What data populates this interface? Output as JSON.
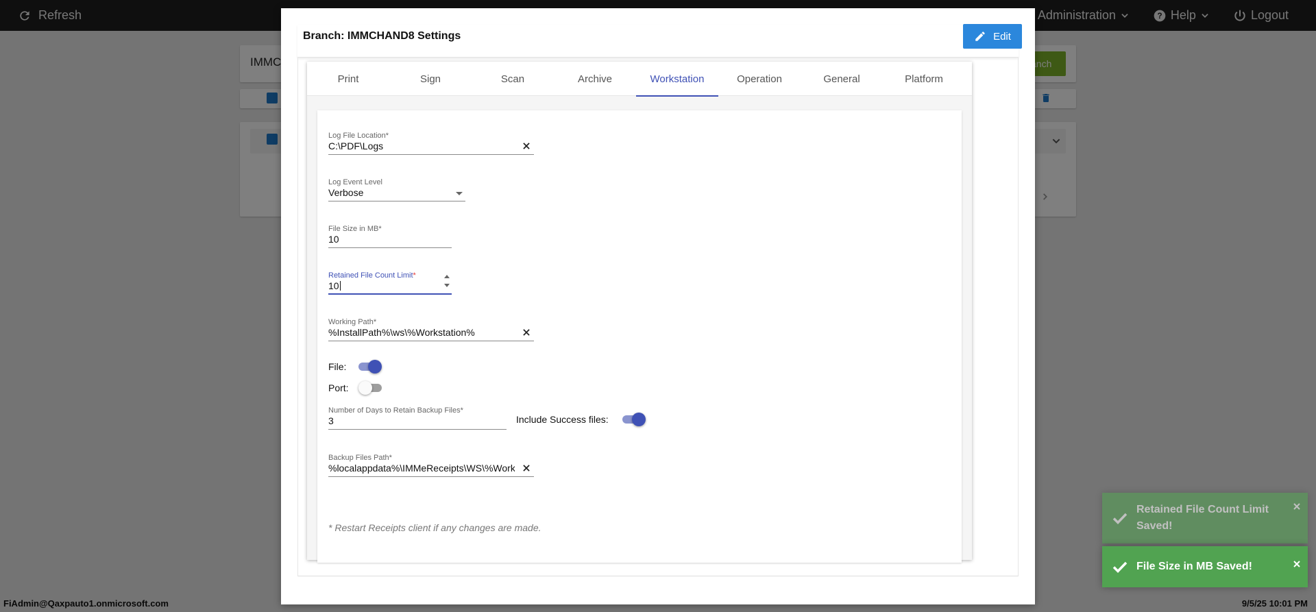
{
  "topbar": {
    "refresh_label": "Refresh",
    "administration_label": "Administration",
    "help_label": "Help",
    "logout_label": "Logout"
  },
  "background": {
    "search_value": "IMMC",
    "branch_button_label": "anch"
  },
  "modal": {
    "title": "Branch: IMMCHAND8 Settings",
    "edit_label": "Edit",
    "tabs": [
      {
        "label": "Print",
        "active": false
      },
      {
        "label": "Sign",
        "active": false
      },
      {
        "label": "Scan",
        "active": false
      },
      {
        "label": "Archive",
        "active": false
      },
      {
        "label": "Workstation",
        "active": true
      },
      {
        "label": "Operation",
        "active": false
      },
      {
        "label": "General",
        "active": false
      },
      {
        "label": "Platform",
        "active": false
      }
    ],
    "form": {
      "log_file_location": {
        "label": "Log File Location",
        "value": "C:\\PDF\\Logs"
      },
      "log_event_level": {
        "label": "Log Event Level",
        "value": "Verbose"
      },
      "file_size": {
        "label": "File Size in MB",
        "value": "10"
      },
      "retained_file_count": {
        "label": "Retained File Count Limit",
        "value": "10"
      },
      "working_path": {
        "label": "Working Path",
        "value": "%InstallPath%\\ws\\%Workstation%"
      },
      "file_toggle": {
        "label": "File:",
        "on": true
      },
      "port_toggle": {
        "label": "Port:",
        "on": false
      },
      "backup_days": {
        "label": "Number of Days to Retain Backup Files",
        "value": "3"
      },
      "include_success": {
        "label": "Include Success files:",
        "on": true
      },
      "backup_path": {
        "label": "Backup Files Path",
        "value": "%localappdata%\\IMMeReceipts\\WS\\%Work"
      },
      "required_mark": "*",
      "note": "* Restart Receipts client if any changes are made."
    }
  },
  "toasts": [
    {
      "message": "Retained File Count Limit Saved!"
    },
    {
      "message": "File Size in MB Saved!"
    }
  ],
  "statusbar": {
    "user": "FiAdmin@Qaxpauto1.onmicrosoft.com",
    "datetime": "9/5/25 10:01 PM"
  },
  "colors": {
    "accent": "#3f51b5",
    "edit_button": "#2b87dc",
    "toast_success": "#51a351",
    "topbar": "#1f1f1f"
  }
}
